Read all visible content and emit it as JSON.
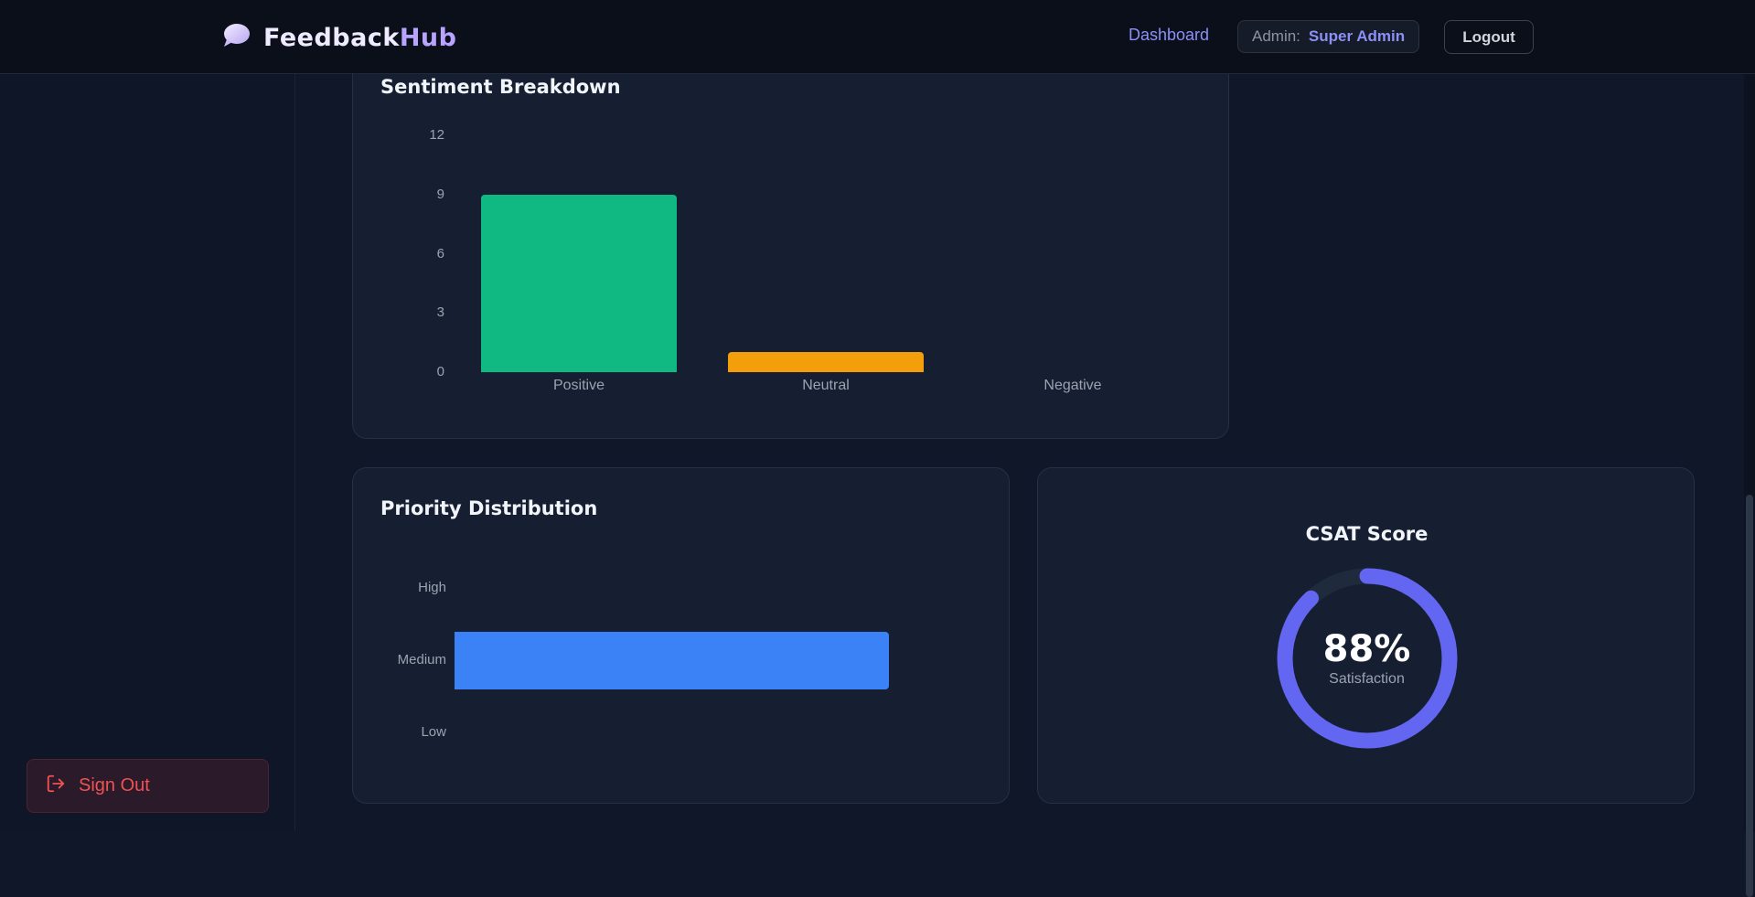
{
  "header": {
    "brand_a": "Feedback",
    "brand_b": "Hub",
    "nav_dashboard": "Dashboard",
    "admin_label": "Admin:",
    "admin_name": "Super Admin",
    "logout_label": "Logout"
  },
  "sidebar": {
    "signout_label": "Sign Out"
  },
  "sentiment": {
    "title": "Sentiment Breakdown",
    "chart_data": {
      "type": "bar",
      "categories": [
        "Positive",
        "Neutral",
        "Negative"
      ],
      "values": [
        9,
        1,
        0
      ],
      "colors": [
        "#10b981",
        "#f59e0b",
        "#ef4444"
      ],
      "yticks": [
        "0",
        "3",
        "6",
        "9",
        "12"
      ],
      "ylim": [
        0,
        12
      ]
    }
  },
  "priority": {
    "title": "Priority Distribution",
    "chart_data": {
      "type": "bar",
      "orientation": "horizontal",
      "categories": [
        "High",
        "Medium",
        "Low"
      ],
      "values": [
        0,
        1,
        0
      ],
      "color": "#3b82f6",
      "xlim": [
        0,
        1.2
      ]
    }
  },
  "csat": {
    "title": "CSAT Score",
    "value": "88%",
    "fraction": 0.88,
    "subtitle": "Satisfaction",
    "color": "#6366f1"
  },
  "colors": {
    "accent": "#8b8ff8",
    "danger": "#f05252",
    "background": "#0f1729",
    "card": "#161f32"
  }
}
